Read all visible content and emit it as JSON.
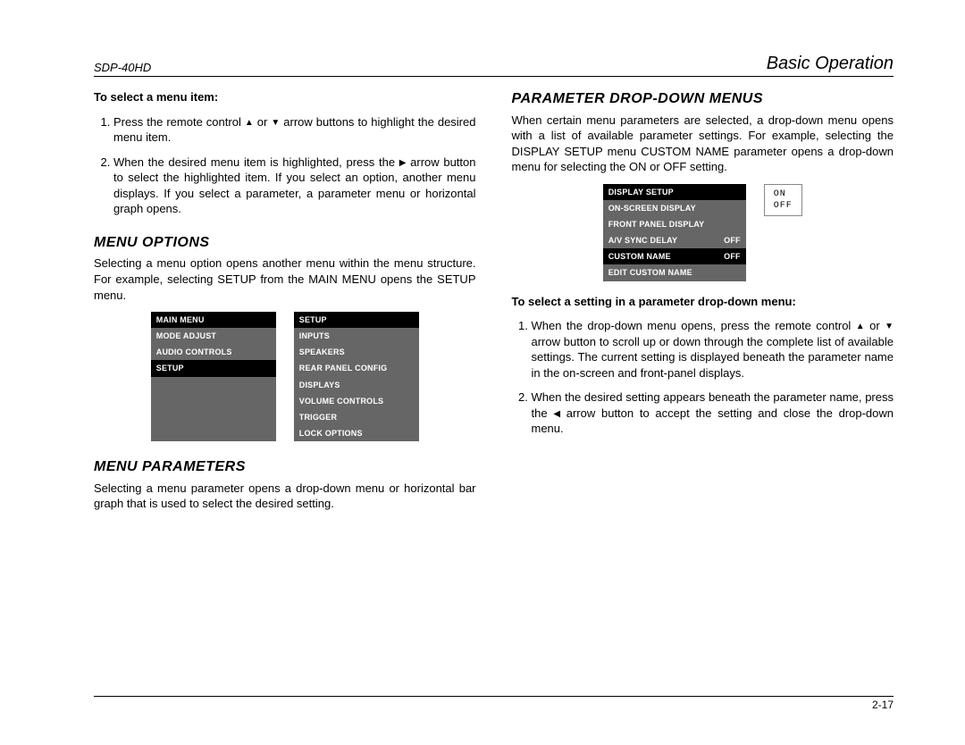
{
  "header": {
    "model": "SDP-40HD",
    "section": "Basic Operation"
  },
  "footer": {
    "page": "2-17"
  },
  "left": {
    "select_heading": "To select a menu item:",
    "select_steps": [
      {
        "pre": "Press the remote control ",
        "mid": " or ",
        "post": " arrow buttons to highlight the desired menu item."
      },
      {
        "pre": "When the desired menu item is highlighted, press the ",
        "post": " arrow button to select the highlighted item. If you select an option, another menu displays. If you select a parameter, a parameter menu or horizontal graph opens."
      }
    ],
    "options_heading": "MENU OPTIONS",
    "options_para": "Selecting a menu option opens another menu within the menu structure. For example, selecting SETUP from the MAIN MENU opens the SETUP menu.",
    "main_menu": {
      "title": "MAIN MENU",
      "items": [
        "MODE ADJUST",
        "AUDIO CONTROLS",
        "SETUP"
      ],
      "highlight_index": 2
    },
    "setup_menu": {
      "title": "SETUP",
      "items": [
        "INPUTS",
        "SPEAKERS",
        "REAR PANEL CONFIG",
        "DISPLAYS",
        "VOLUME CONTROLS",
        "TRIGGER",
        "LOCK OPTIONS"
      ]
    },
    "params_heading": "MENU PARAMETERS",
    "params_para": "Selecting a menu parameter opens a drop-down menu or horizontal bar graph that is used to select the desired setting."
  },
  "right": {
    "dd_heading": "PARAMETER DROP-DOWN MENUS",
    "dd_para": "When certain menu parameters are selected, a drop-down menu opens with a list of available parameter settings. For example, selecting the DISPLAY SETUP menu CUSTOM NAME parameter opens a drop-down menu for selecting the ON or OFF setting.",
    "display_menu": {
      "title": "DISPLAY SETUP",
      "rows": [
        {
          "l": "ON-SCREEN DISPLAY",
          "r": ""
        },
        {
          "l": "FRONT PANEL DISPLAY",
          "r": ""
        },
        {
          "l": "A/V SYNC DELAY",
          "r": "OFF"
        },
        {
          "l": "CUSTOM NAME",
          "r": "OFF",
          "hl": true
        },
        {
          "l": "EDIT CUSTOM NAME",
          "r": ""
        }
      ]
    },
    "dropdown": {
      "opt1": "ON",
      "opt2": "OFF"
    },
    "dd_select_heading": "To select a setting in a parameter drop-down menu:",
    "dd_steps": [
      {
        "pre": "When the drop-down menu opens, press the remote control ",
        "mid": " or ",
        "post": " arrow button to scroll up or down through the complete list of available settings. The current setting is displayed beneath the parameter name in the on-screen and front-panel displays."
      },
      {
        "pre": "When the desired setting appears beneath the parameter name, press the ",
        "post": " arrow button to accept the setting and close the drop-down menu."
      }
    ]
  }
}
